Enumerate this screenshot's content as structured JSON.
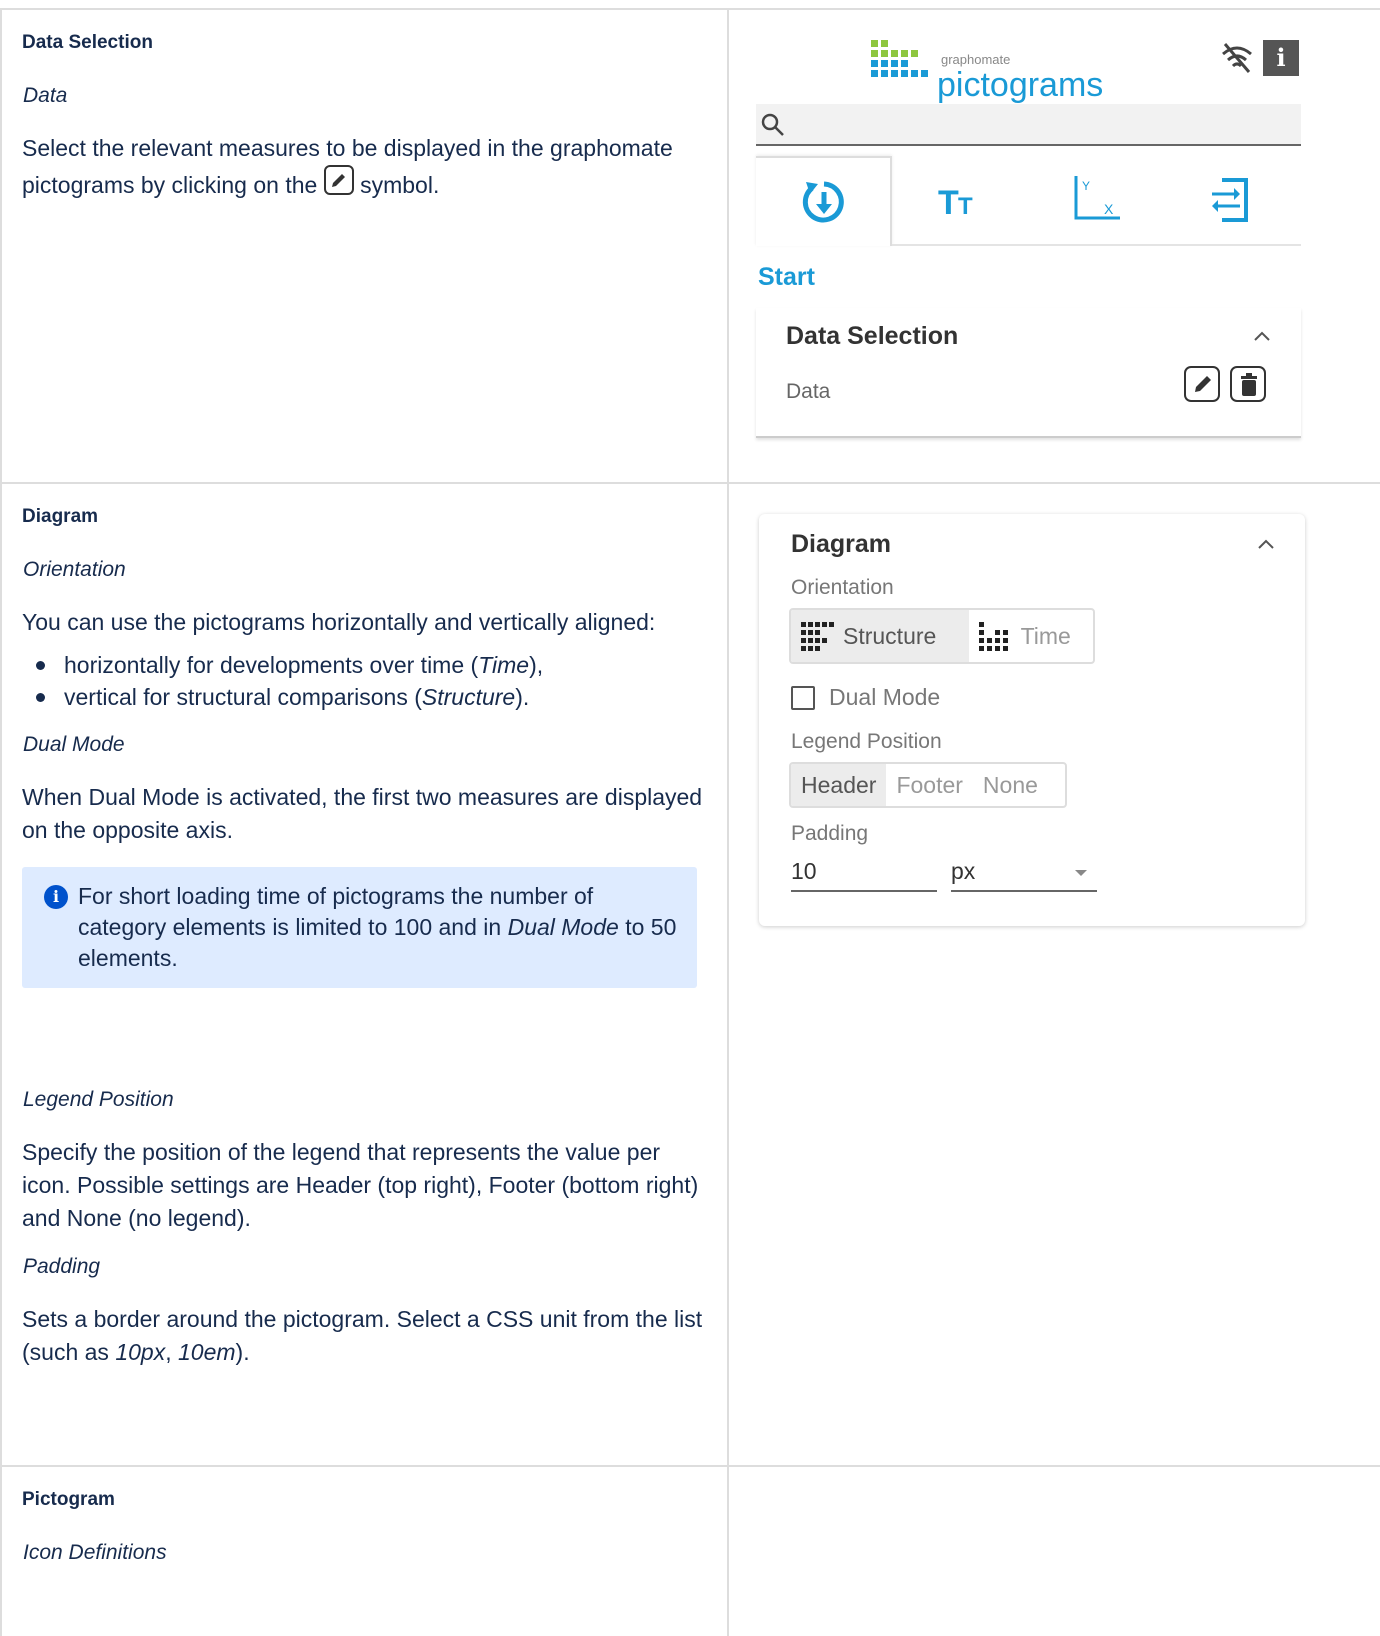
{
  "left": {
    "data_selection": {
      "heading": "Data Selection",
      "sub": "Data",
      "text_before": "Select the relevant measures to be displayed in the graphomate pictograms by clicking on the",
      "text_after": "symbol."
    },
    "diagram": {
      "heading": "Diagram",
      "orientation_sub": "Orientation",
      "orientation_text": "You can use the pictograms horizontally and vertically aligned:",
      "bullet1_a": "horizontally for developments over time (",
      "bullet1_em": "Time",
      "bullet1_b": "),",
      "bullet2_a": "vertical for structural comparisons (",
      "bullet2_em": "Structure",
      "bullet2_b": ").",
      "dual_sub": "Dual Mode",
      "dual_text": "When Dual Mode is activated, the first two measures are displayed on the opposite axis.",
      "info_a": "For short loading time of pictograms the number of category elements is limited to 100 and in",
      "info_em": "Dual Mode",
      "info_b": "to 50 elements.",
      "legend_sub": "Legend Position",
      "legend_text": "Specify the position of the legend that represents the value per icon. Possible settings are Header (top right), Footer (bottom right) and None (no legend).",
      "padding_sub": "Padding",
      "padding_text_a": "Sets a border around the pictogram. Select a CSS unit from the list (such as",
      "padding_em1": "10px",
      "padding_sep": ",",
      "padding_em2": "10em",
      "padding_end": ")."
    },
    "pictogram": {
      "heading": "Pictogram",
      "sub": "Icon Definitions"
    }
  },
  "panel": {
    "logo_small": "graphomate",
    "logo_big": "pictograms",
    "info_button": "i",
    "tab_text_icon": "Tт",
    "start_label": "Start",
    "data_selection_title": "Data Selection",
    "data_label": "Data",
    "diagram_title": "Diagram",
    "orientation_label": "Orientation",
    "orientation_options": [
      "Structure",
      "Time"
    ],
    "dual_mode_label": "Dual Mode",
    "legend_label": "Legend Position",
    "legend_options": [
      "Header",
      "Footer",
      "None"
    ],
    "padding_label": "Padding",
    "padding_value": "10",
    "padding_unit": "px"
  },
  "colors": {
    "accent": "#1a9ad6",
    "info_bg": "#deebff",
    "info_icon": "#0052cc"
  }
}
